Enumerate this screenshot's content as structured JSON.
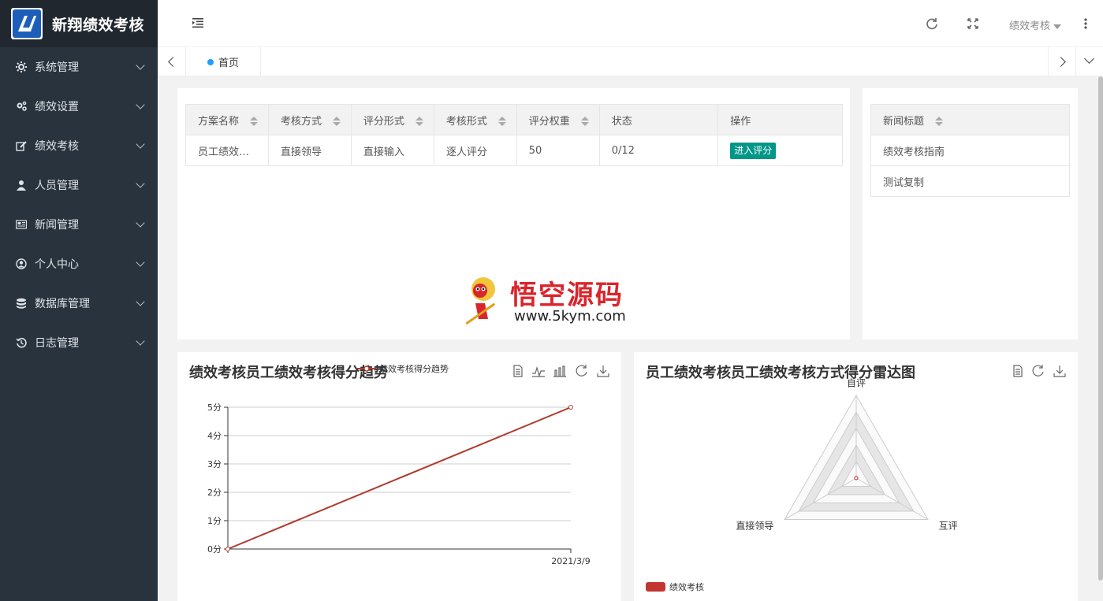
{
  "app": {
    "title": "新翔绩效考核"
  },
  "sidebar": {
    "items": [
      {
        "label": "系统管理",
        "icon": "gear-icon"
      },
      {
        "label": "绩效设置",
        "icon": "gears-icon"
      },
      {
        "label": "绩效考核",
        "icon": "edit-icon"
      },
      {
        "label": "人员管理",
        "icon": "user-icon"
      },
      {
        "label": "新闻管理",
        "icon": "newspaper-icon"
      },
      {
        "label": "个人中心",
        "icon": "user-circle-icon"
      },
      {
        "label": "数据库管理",
        "icon": "database-icon"
      },
      {
        "label": "日志管理",
        "icon": "history-icon"
      }
    ]
  },
  "header": {
    "user_menu_label": "绩效考核"
  },
  "tabs": {
    "home_label": "首页"
  },
  "assessment_table": {
    "headers": [
      "方案名称",
      "考核方式",
      "评分形式",
      "考核形式",
      "评分权重",
      "状态",
      "操作"
    ],
    "rows": [
      {
        "plan_name": "员工绩效…",
        "method": "直接领导",
        "score_type": "直接输入",
        "form": "逐人评分",
        "weight": "50",
        "status": "0/12",
        "action": "进入评分"
      }
    ]
  },
  "news_table": {
    "header": "新闻标题",
    "rows": [
      "绩效考核指南",
      "测试复制"
    ]
  },
  "watermark": {
    "cn": "悟空源码",
    "url": "www.5kym.com"
  },
  "colors": {
    "sidebar": "#28333e",
    "accent": "#009688",
    "series": "#b03a2e"
  },
  "chart_data": [
    {
      "type": "line",
      "title": "绩效考核员工绩效考核得分趋势",
      "legend": [
        "绩效考核得分趋势"
      ],
      "x": [
        "",
        "2021/3/9"
      ],
      "y_ticks": [
        "0分",
        "1分",
        "2分",
        "3分",
        "4分",
        "5分"
      ],
      "ylim": [
        0,
        5
      ],
      "series": [
        {
          "name": "绩效考核得分趋势",
          "values": [
            0,
            5
          ]
        }
      ],
      "grid": true
    },
    {
      "type": "radar",
      "title": "员工绩效考核员工绩效考核方式得分雷达图",
      "indicators": [
        "自评",
        "互评",
        "直接领导"
      ],
      "series": [
        {
          "name": "绩效考核",
          "values": [
            0,
            0,
            0
          ]
        }
      ],
      "legend_placement": "bottom-left"
    }
  ]
}
